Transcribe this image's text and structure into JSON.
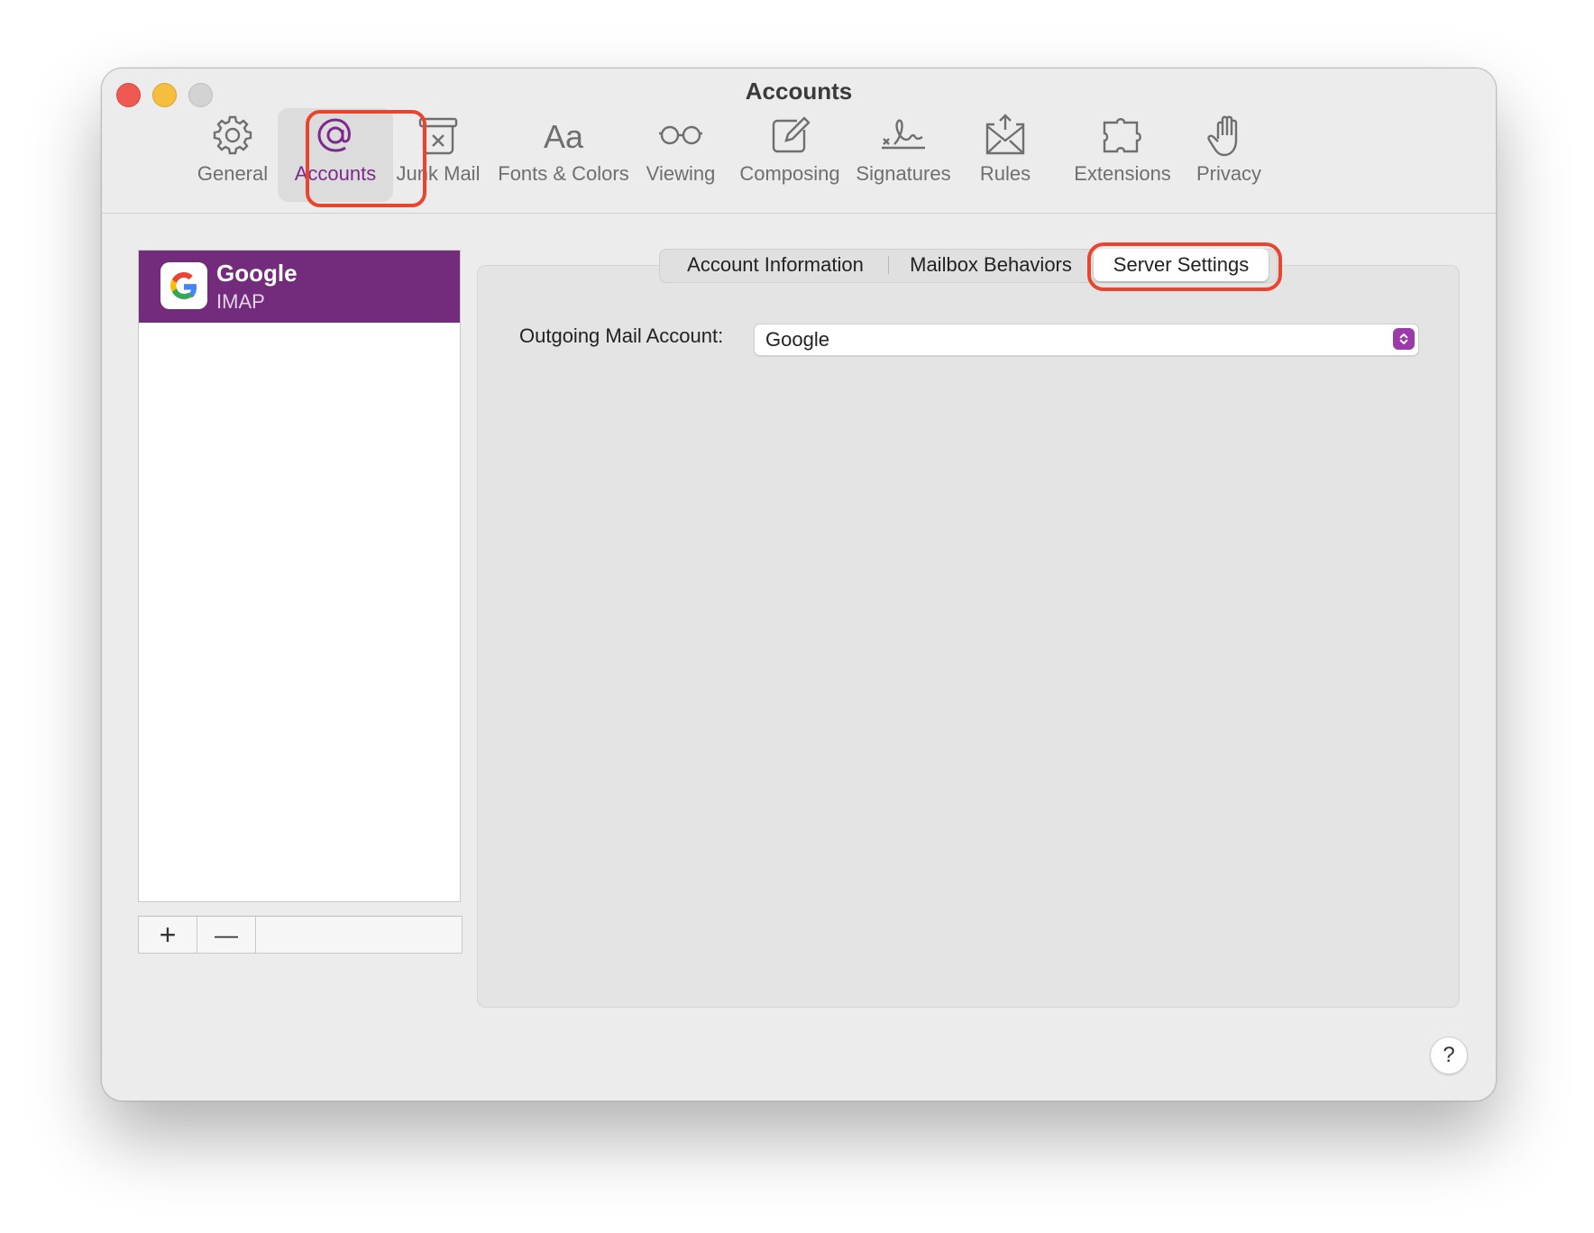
{
  "window": {
    "title": "Accounts"
  },
  "toolbar": {
    "items": [
      {
        "label": "General",
        "icon": "gear-icon"
      },
      {
        "label": "Accounts",
        "icon": "at-sign-icon",
        "selected": true
      },
      {
        "label": "Junk Mail",
        "icon": "trash-x-icon"
      },
      {
        "label": "Fonts & Colors",
        "icon": "font-aa-icon"
      },
      {
        "label": "Viewing",
        "icon": "glasses-icon"
      },
      {
        "label": "Composing",
        "icon": "compose-icon"
      },
      {
        "label": "Signatures",
        "icon": "signature-icon"
      },
      {
        "label": "Rules",
        "icon": "envelope-arrows-icon"
      },
      {
        "label": "Extensions",
        "icon": "puzzle-icon"
      },
      {
        "label": "Privacy",
        "icon": "hand-icon"
      }
    ]
  },
  "sidebar": {
    "accounts": [
      {
        "name": "Google",
        "type": "IMAP",
        "icon": "google-logo-icon"
      }
    ],
    "add_label": "+",
    "remove_label": "—"
  },
  "tabs": [
    {
      "label": "Account Information"
    },
    {
      "label": "Mailbox Behaviors"
    },
    {
      "label": "Server Settings",
      "selected": true
    }
  ],
  "form": {
    "outgoing_label": "Outgoing Mail Account:",
    "outgoing_value": "Google"
  },
  "help_label": "?",
  "colors": {
    "accent": "#732c7b",
    "highlight": "#e8452f"
  }
}
